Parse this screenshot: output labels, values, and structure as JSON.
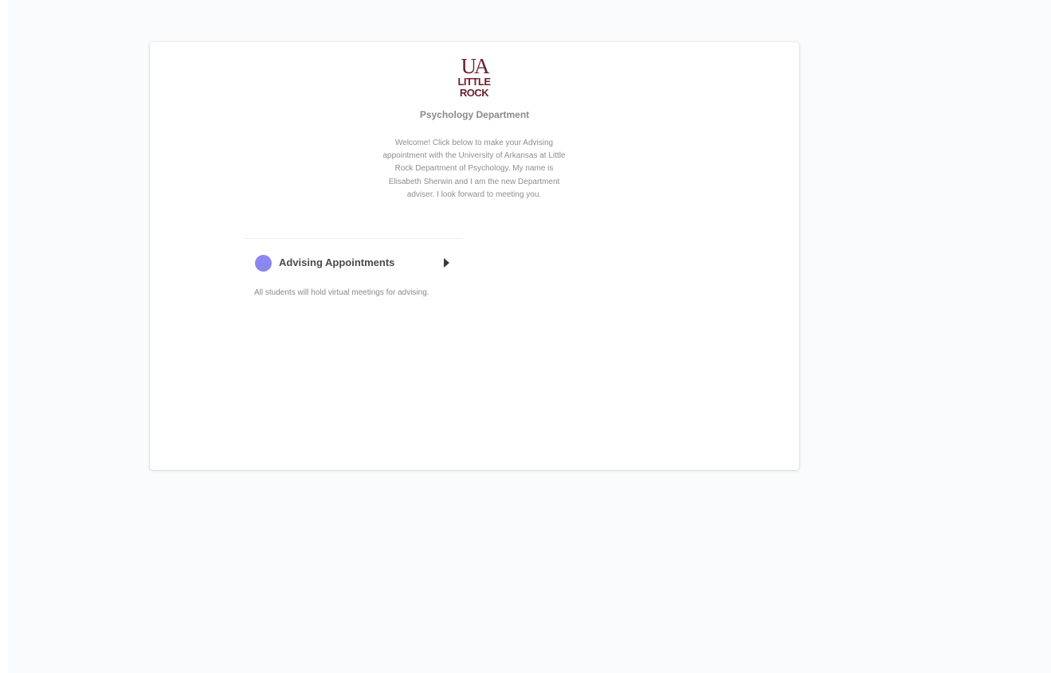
{
  "logo": {
    "name": "ua-little-rock-logo",
    "text_top": "UA",
    "text_mid": "LITTLE",
    "text_bottom": "ROCK",
    "color": "#6b1f2e"
  },
  "page": {
    "title": "Psychology Department",
    "welcome": "Welcome! Click below to make your Advising appointment with the University of Arkansas at Little Rock Department of Psychology. My name is Elisabeth Sherwin and I am the new Department adviser. I look forward to meeting you."
  },
  "event": {
    "name": "Advising Appointments",
    "dot_color": "#8b87f0",
    "caret_icon": "caret-right-icon",
    "description": "All students will hold virtual meetings for advising."
  },
  "colors": {
    "page_bg": "#fafbfd",
    "card_bg": "#ffffff",
    "text_muted": "#8a8a8a",
    "text_strong": "#4a4a4a"
  }
}
